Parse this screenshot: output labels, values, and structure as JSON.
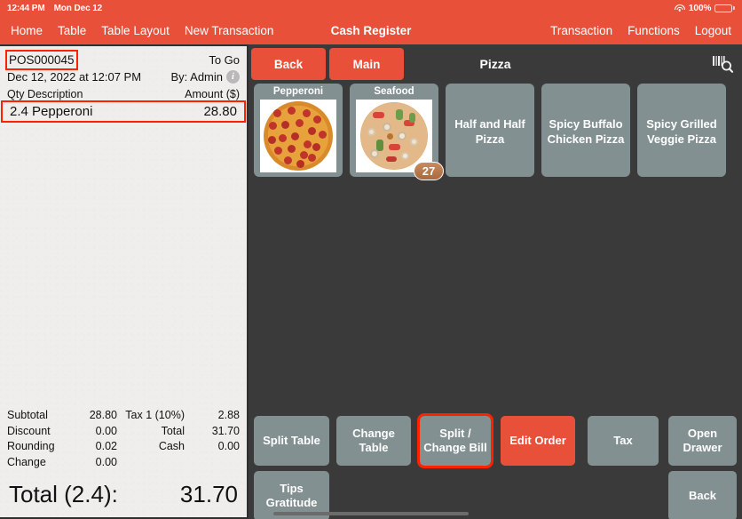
{
  "statusbar": {
    "time": "12:44 PM",
    "date": "Mon Dec 12",
    "battery": "100%",
    "wifi_icon": "wifi-icon",
    "battery_icon": "battery-icon"
  },
  "navbar": {
    "title": "Cash Register",
    "left_items": [
      {
        "label": "Home",
        "name": "nav-item-home"
      },
      {
        "label": "Table",
        "name": "nav-item-table"
      },
      {
        "label": "Table Layout",
        "name": "nav-item-table-layout"
      },
      {
        "label": "New Transaction",
        "name": "nav-item-new-transaction"
      }
    ],
    "right_items": [
      {
        "label": "Transaction",
        "name": "nav-item-transaction"
      },
      {
        "label": "Functions",
        "name": "nav-item-functions"
      },
      {
        "label": "Logout",
        "name": "nav-item-logout"
      }
    ]
  },
  "receipt": {
    "order_id": "POS000045",
    "order_type": "To Go",
    "datetime": "Dec 12, 2022 at 12:07 PM",
    "operator": "By: Admin",
    "info_icon": "info-icon",
    "col_qty_desc": "Qty  Description",
    "col_amount": "Amount ($)",
    "lines": [
      {
        "qty_desc": "2.4 Pepperoni",
        "amount": "28.80"
      }
    ],
    "totals": [
      {
        "label": "Subtotal",
        "value": "28.80",
        "label2": "Tax 1 (10%)",
        "value2": "2.88"
      },
      {
        "label": "Discount",
        "value": "0.00",
        "label2": "Total",
        "value2": "31.70"
      },
      {
        "label": "Rounding",
        "value": "0.02",
        "label2": "Cash",
        "value2": "0.00"
      },
      {
        "label": "Change",
        "value": "0.00",
        "label2": "",
        "value2": ""
      }
    ],
    "grand_label": "Total (2.4):",
    "grand_value": "31.70"
  },
  "catalog": {
    "toolbar": {
      "back": "Back",
      "main": "Main",
      "title": "Pizza",
      "scan_icon": "barcode-scan-icon"
    },
    "tiles": [
      {
        "label": "Pepperoni",
        "type": "image",
        "art": "pepperoni",
        "badge": ""
      },
      {
        "label": "Seafood",
        "type": "image",
        "art": "seafood",
        "badge": "27"
      },
      {
        "label": "Half and Half Pizza",
        "type": "text"
      },
      {
        "label": "Spicy Buffalo Chicken Pizza",
        "type": "text"
      },
      {
        "label": "Spicy Grilled Veggie Pizza",
        "type": "text"
      }
    ]
  },
  "actions": [
    {
      "label": "Split Table",
      "name": "split-table-button",
      "style": "grey",
      "selected": false
    },
    {
      "label": "Tips Gratitude",
      "name": "tips-gratitude-button",
      "style": "grey",
      "selected": false
    },
    {
      "label": "Change Table",
      "name": "change-table-button",
      "style": "grey",
      "selected": false
    },
    {
      "label": "Split / Change Bill",
      "name": "split-change-bill-button",
      "style": "grey",
      "selected": true
    },
    {
      "label": "Edit Order",
      "name": "edit-order-button",
      "style": "red",
      "selected": false
    },
    {
      "label": "Tax",
      "name": "tax-button",
      "style": "grey",
      "selected": false
    },
    {
      "label": "Open Drawer",
      "name": "open-drawer-button",
      "style": "grey",
      "selected": false
    },
    {
      "label": "Back",
      "name": "back-bottom-button",
      "style": "grey",
      "selected": false
    }
  ],
  "colors": {
    "accent": "#e8503a",
    "panel": "#3a3a3a",
    "tile": "#839091",
    "highlight": "#ff2200",
    "receipt_bg": "#f0eeec"
  }
}
